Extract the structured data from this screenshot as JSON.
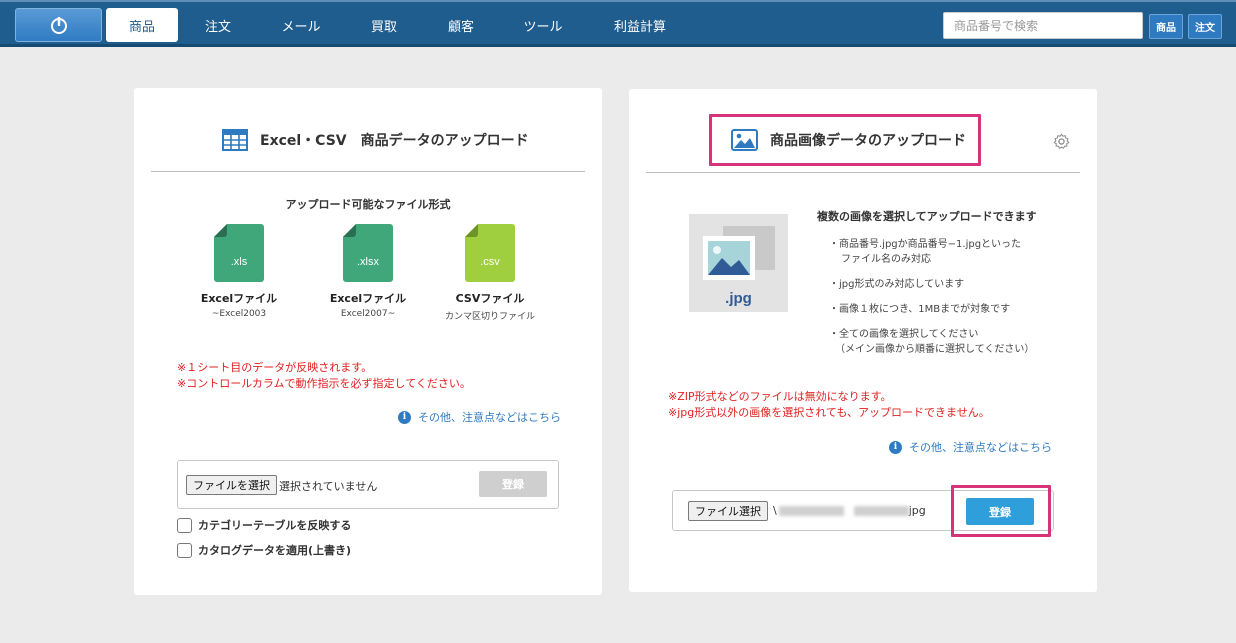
{
  "nav": {
    "items": [
      "商品",
      "注文",
      "メール",
      "買取",
      "顧客",
      "ツール",
      "利益計算"
    ],
    "search_placeholder": "商品番号で検索",
    "btn_product": "商品",
    "btn_order": "注文"
  },
  "left": {
    "title": "Excel・CSV　商品データのアップロード",
    "formats_heading": "アップロード可能なファイル形式",
    "files": [
      {
        "ext": ".xls",
        "name": "Excelファイル",
        "sub": "~Excel2003"
      },
      {
        "ext": ".xlsx",
        "name": "Excelファイル",
        "sub": "Excel2007~"
      },
      {
        "ext": ".csv",
        "name": "CSVファイル",
        "sub": "カンマ区切りファイル"
      }
    ],
    "notes": [
      "※１シート目のデータが反映されます。",
      "※コントロールカラムで動作指示を必ず指定してください。"
    ],
    "info_link": "その他、注意点などはこちら",
    "file_button": "ファイルを選択",
    "file_status": "選択されていません",
    "register": "登録",
    "checkboxes": [
      "カテゴリーテーブルを反映する",
      "カタログデータを適用(上書き)"
    ]
  },
  "right": {
    "title": "商品画像データのアップロード",
    "jpg_label": ".jpg",
    "desc_heading": "複数の画像を選択してアップロードできます",
    "bullets": [
      "・商品番号.jpgか商品番号−1.jpgといった",
      "ファイル名のみ対応",
      "・jpg形式のみ対応しています",
      "・画像１枚につき、1MBまでが対象です",
      "・全ての画像を選択してください",
      "（メイン画像から順番に選択してください）"
    ],
    "notes": [
      "※ZIP形式などのファイルは無効になります。",
      "※jpg形式以外の画像を選択されても、アップロードできません。"
    ],
    "info_link": "その他、注意点などはこちら",
    "file_button": "ファイル選択",
    "file_prefix": "\\",
    "file_suffix": "jpg",
    "register": "登録"
  },
  "colors": {
    "nav_bg": "#1f5d8e",
    "accent_blue": "#2f7bc2",
    "highlight_pink": "#d8327b",
    "note_red": "#e02020",
    "excel_green": "#3fa77a",
    "csv_green": "#9fcf3e"
  }
}
